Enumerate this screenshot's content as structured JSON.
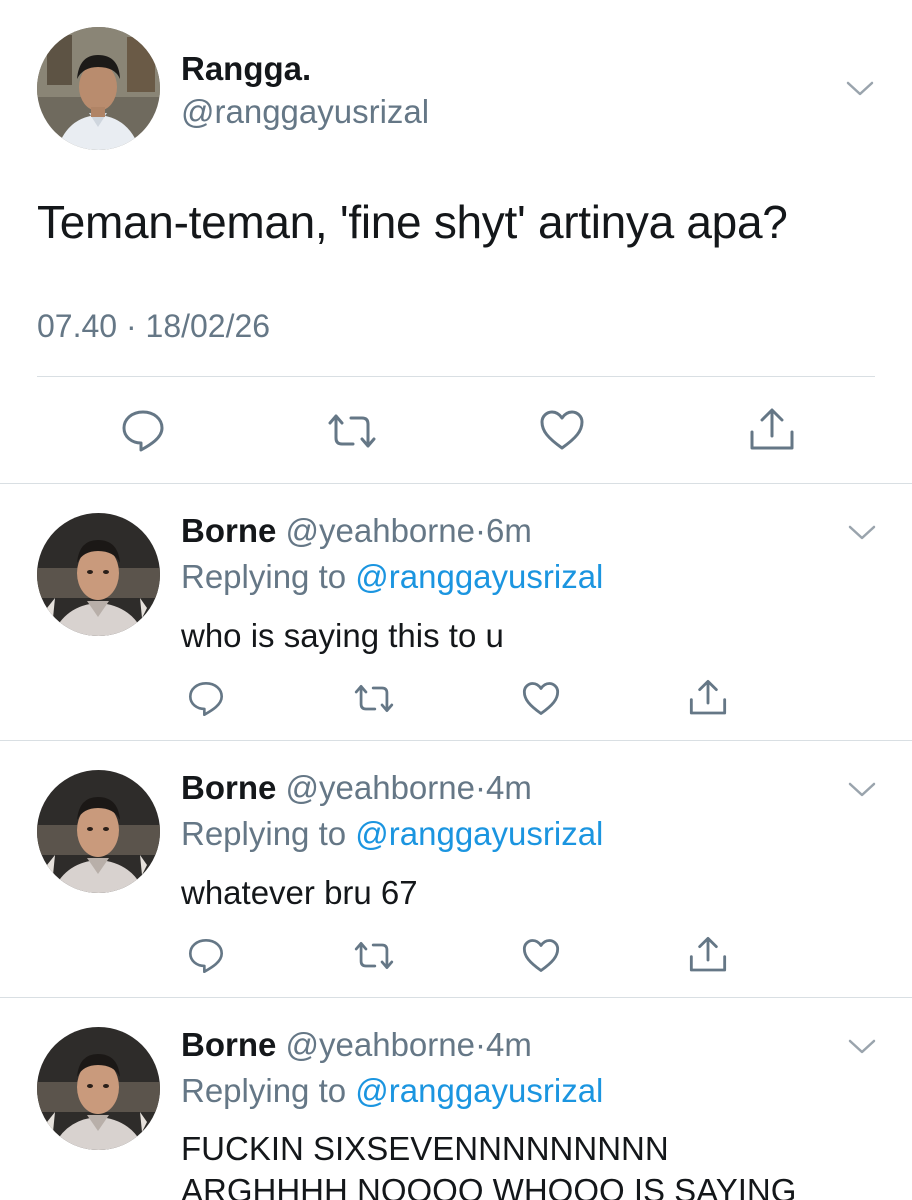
{
  "main_tweet": {
    "name": "Rangga.",
    "handle": "@ranggayusrizal",
    "text": "Teman-teman, 'fine shyt' artinya apa?",
    "timestamp": "07.40 · 18/02/26",
    "actions": [
      "reply-icon",
      "retweet-icon",
      "like-icon",
      "share-icon"
    ]
  },
  "replies": [
    {
      "name": "Borne",
      "handle": "@yeahborne",
      "separator": "·",
      "time": "6m",
      "replying_prefix": "Replying to",
      "replying_to": "@ranggayusrizal",
      "text_line1": "who is saying this to u",
      "text_line2": ""
    },
    {
      "name": "Borne",
      "handle": "@yeahborne",
      "separator": "·",
      "time": "4m",
      "replying_prefix": "Replying to",
      "replying_to": "@ranggayusrizal",
      "text_line1": "whatever bru 67",
      "text_line2": ""
    },
    {
      "name": "Borne",
      "handle": "@yeahborne",
      "separator": "·",
      "time": "4m",
      "replying_prefix": "Replying to",
      "replying_to": "@ranggayusrizal",
      "text_line1": "FUCKIN SIXSEVENNNNNNNNN",
      "text_line2": "ARGHHHH NOOOO WHOOO IS SAYING"
    }
  ],
  "colors": {
    "text": "#14171a",
    "secondary": "#657786",
    "link": "#1b95e0",
    "divider": "#d9dfe3",
    "icon": "#657786"
  }
}
